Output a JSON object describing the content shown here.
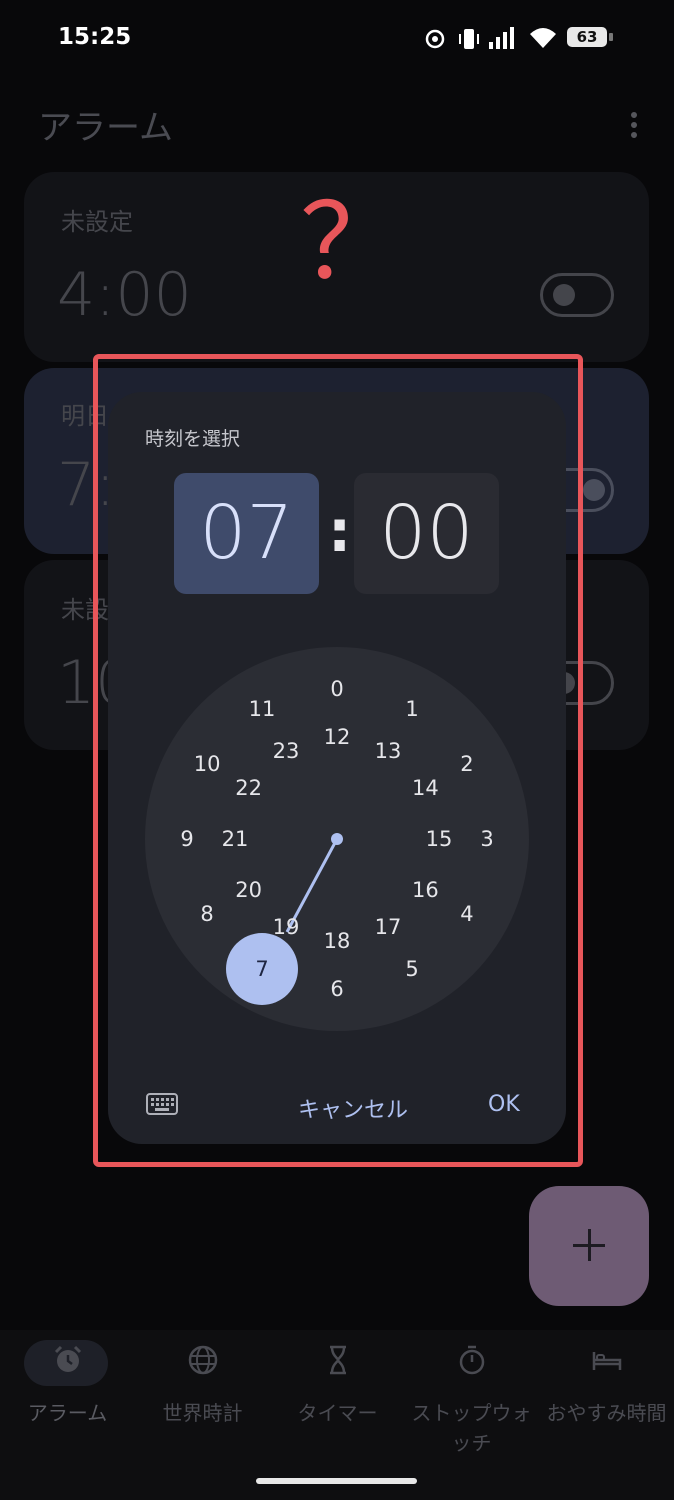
{
  "status_bar": {
    "time": "15:25",
    "battery": "63"
  },
  "header": {
    "title": "アラーム"
  },
  "alarms": [
    {
      "label": "未設定",
      "time": "4:00"
    },
    {
      "label": "明日",
      "time": "7:"
    },
    {
      "label": "未設",
      "time": "10"
    }
  ],
  "annotation": {
    "mark": "？"
  },
  "dialog": {
    "title": "時刻を選択",
    "hour": "07",
    "minute": "00",
    "separator": ":",
    "selected_hour": "7",
    "outer_numbers": [
      "0",
      "1",
      "2",
      "3",
      "4",
      "5",
      "6",
      "7",
      "8",
      "9",
      "10",
      "11"
    ],
    "inner_numbers": [
      "12",
      "13",
      "14",
      "15",
      "16",
      "17",
      "18",
      "19",
      "20",
      "21",
      "22",
      "23"
    ],
    "cancel_label": "キャンセル",
    "ok_label": "OK"
  },
  "nav": {
    "items": [
      {
        "label": "アラーム",
        "icon": "alarm-clock-icon"
      },
      {
        "label": "世界時計",
        "icon": "globe-icon"
      },
      {
        "label": "タイマー",
        "icon": "hourglass-icon"
      },
      {
        "label": "ストップウォッチ",
        "icon": "stopwatch-icon"
      },
      {
        "label": "おやすみ時間",
        "icon": "bed-icon"
      }
    ]
  },
  "colors": {
    "accent": "#aec0f0",
    "highlight": "#e8565a",
    "hour_bg": "#3f4b6b",
    "fab": "#6e5b74"
  }
}
